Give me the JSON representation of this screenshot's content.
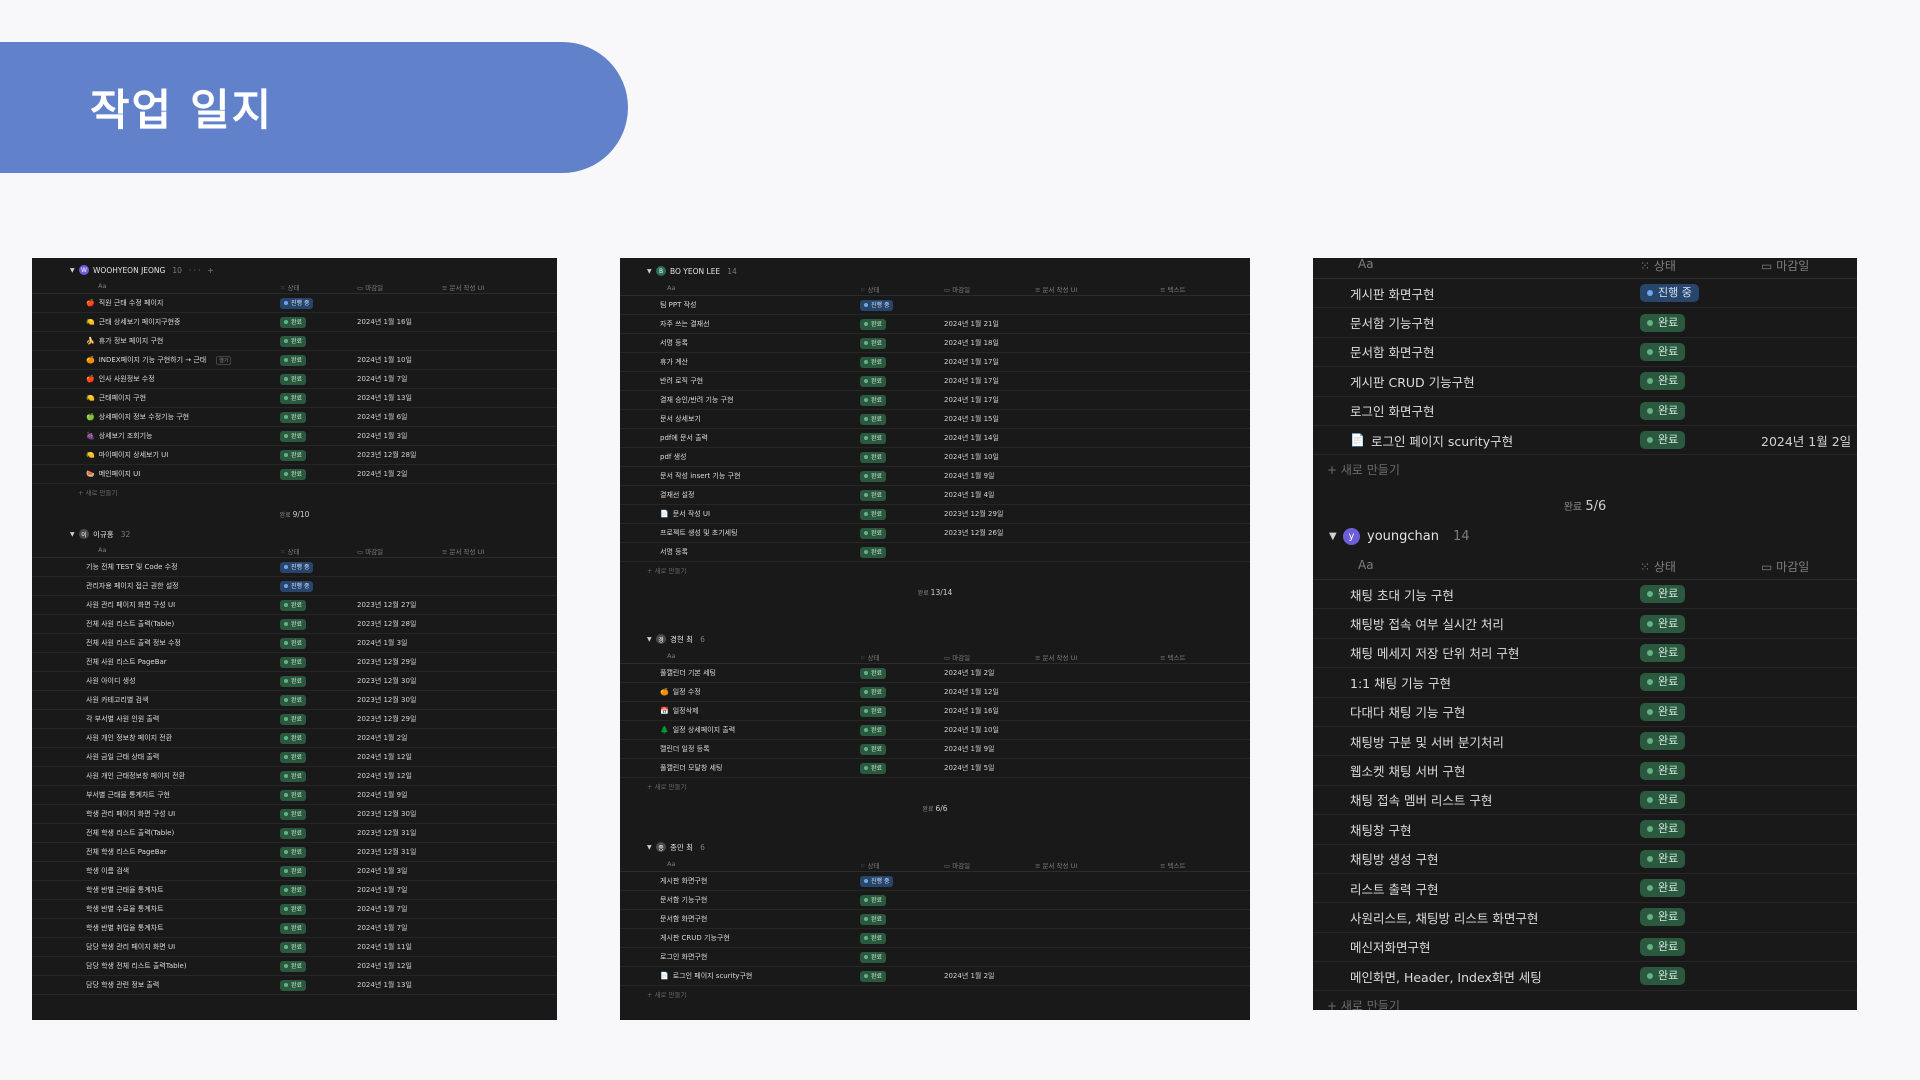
{
  "page": {
    "title": "작업 일지"
  },
  "labels": {
    "col_name": "Aa",
    "col_status": "상태",
    "col_deadline": "마감일",
    "col_doc": "문서 작성 UI",
    "col_text": "텍스트",
    "new_row": "+ 새로 만들기",
    "done": "완료"
  },
  "status": {
    "done": "완료",
    "progress": "진행 중"
  },
  "p1": {
    "g1": {
      "avatar": "W",
      "name": "WOOHYEON JEONG",
      "count": "10",
      "tools": "··· +",
      "summary": "9/10",
      "rows": [
        {
          "icon": "🍎",
          "name": "직원 근태 수정 페이지",
          "status": "진행 중",
          "date": ""
        },
        {
          "icon": "🍋",
          "name": "근태 상세보기 페이지구현중",
          "status": "완료",
          "date": "2024년 1월 16일"
        },
        {
          "icon": "🍌",
          "name": "휴가 정보 페이지 구현",
          "status": "완료",
          "date": ""
        },
        {
          "icon": "🍊",
          "name": "INDEX페이지 기능 구현하기 → 근태",
          "status": "완료",
          "date": "2024년 1월 10일",
          "tag": "열기"
        },
        {
          "icon": "🍎",
          "name": "인사 사원정보 수정",
          "status": "완료",
          "date": "2024년 1월 7일"
        },
        {
          "icon": "🍋",
          "name": "근태페이지 구현",
          "status": "완료",
          "date": "2024년 1월 13일"
        },
        {
          "icon": "🍏",
          "name": "상세페이지 정보 수정기능 구현",
          "status": "완료",
          "date": "2024년 1월 6일"
        },
        {
          "icon": "🍇",
          "name": "상세보기 조회기능",
          "status": "완료",
          "date": "2024년 1월 3일"
        },
        {
          "icon": "🍋",
          "name": "마이페이지 상세보기 UI",
          "status": "완료",
          "date": "2023년 12월 28일"
        },
        {
          "icon": "🍉",
          "name": "메인페이지 UI",
          "status": "완료",
          "date": "2024년 1월 2일"
        }
      ]
    },
    "g2": {
      "avatar": "이",
      "name": "이규홍",
      "count": "32",
      "rows": [
        {
          "name": "기능 전체 TEST 및 Code 수정",
          "status": "진행 중",
          "date": ""
        },
        {
          "name": "관리자용 페이지 접근 권한 설정",
          "status": "진행 중",
          "date": ""
        },
        {
          "name": "사원 관리 페이지 화면 구성 UI",
          "status": "완료",
          "date": "2023년 12월 27일"
        },
        {
          "name": "전체 사원 리스트 출력(Table)",
          "status": "완료",
          "date": "2023년 12월 28일"
        },
        {
          "name": "전체 사원 리스트 출력 정보 수정",
          "status": "완료",
          "date": "2024년 1월 3일"
        },
        {
          "name": "전체 사원 리스트 PageBar",
          "status": "완료",
          "date": "2023년 12월 29일"
        },
        {
          "name": "사원 아이디 생성",
          "status": "완료",
          "date": "2023년 12월 30일"
        },
        {
          "name": "사원 카테고리별 검색",
          "status": "완료",
          "date": "2023년 12월 30일"
        },
        {
          "name": "각 부서별 사원 인원 출력",
          "status": "완료",
          "date": "2023년 12월 29일"
        },
        {
          "name": "사원 개인 정보창 페이지 전환",
          "status": "완료",
          "date": "2024년 1월 2일"
        },
        {
          "name": "사원 금일 근태 상태 출력",
          "status": "완료",
          "date": "2024년 1월 12일"
        },
        {
          "name": "사원 개인 근태정보창 페이지 전환",
          "status": "완료",
          "date": "2024년 1월 12일"
        },
        {
          "name": "부서별 근태율 통계차트 구현",
          "status": "완료",
          "date": "2024년 1월 9일"
        },
        {
          "name": "학생 관리 페이지 화면 구성 UI",
          "status": "완료",
          "date": "2023년 12월 30일"
        },
        {
          "name": "전체 학생 리스트 출력(Table)",
          "status": "완료",
          "date": "2023년 12월 31일"
        },
        {
          "name": "전체 학생 리스트 PageBar",
          "status": "완료",
          "date": "2023년 12월 31일"
        },
        {
          "name": "학생 이름 검색",
          "status": "완료",
          "date": "2024년 1월 3일"
        },
        {
          "name": "학생 반별 근태율 통계차트",
          "status": "완료",
          "date": "2024년 1월 7일"
        },
        {
          "name": "학생 반별 수료율 통계차트",
          "status": "완료",
          "date": "2024년 1월 7일"
        },
        {
          "name": "학생 반별 취업율 통계차트",
          "status": "완료",
          "date": "2024년 1월 7일"
        },
        {
          "name": "담당 학생 관리 페이지 화면 UI",
          "status": "완료",
          "date": "2024년 1월 11일"
        },
        {
          "name": "담당 학생 전체 리스트 출력Table)",
          "status": "완료",
          "date": "2024년 1월 12일"
        },
        {
          "name": "담당 학생 관련 정보 출력",
          "status": "완료",
          "date": "2024년 1월 13일"
        }
      ]
    }
  },
  "p2": {
    "g1": {
      "avatar": "B",
      "name": "BO YEON LEE",
      "count": "14",
      "summary": "13/14",
      "rows": [
        {
          "name": "팀 PPT 작성",
          "status": "진행 중",
          "date": ""
        },
        {
          "name": "자주 쓰는 결재선",
          "status": "완료",
          "date": "2024년 1월 21일"
        },
        {
          "name": "서명 등록",
          "status": "완료",
          "date": "2024년 1월 18일"
        },
        {
          "name": "휴가 계산",
          "status": "완료",
          "date": "2024년 1월 17일"
        },
        {
          "name": "반려 로직 구현",
          "status": "완료",
          "date": "2024년 1월 17일"
        },
        {
          "name": "결재 승인/반려 기능 구현",
          "status": "완료",
          "date": "2024년 1월 17일"
        },
        {
          "name": "문서 상세보기",
          "status": "완료",
          "date": "2024년 1월 15일"
        },
        {
          "name": "pdf에 문서 출력",
          "status": "완료",
          "date": "2024년 1월 14일"
        },
        {
          "name": "pdf 생성",
          "status": "완료",
          "date": "2024년 1월 10일"
        },
        {
          "name": "문서 작성 insert 기능 구현",
          "status": "완료",
          "date": "2024년 1월 9일"
        },
        {
          "name": "결재선 설정",
          "status": "완료",
          "date": "2024년 1월 4일"
        },
        {
          "icon": "📄",
          "name": "문서 작성 UI",
          "status": "완료",
          "date": "2023년 12월 29일"
        },
        {
          "name": "프로젝트 생성 및 초기세팅",
          "status": "완료",
          "date": "2023년 12월 26일"
        },
        {
          "name": "서명 등록",
          "status": "완료",
          "date": ""
        }
      ]
    },
    "g2": {
      "avatar": "경",
      "name": "경현 최",
      "count": "6",
      "summary": "6/6",
      "rows": [
        {
          "name": "풀캘린더 기본 세팅",
          "status": "완료",
          "date": "2024년 1월 2일"
        },
        {
          "icon": "🍊",
          "name": "일정 수정",
          "status": "완료",
          "date": "2024년 1월 12일"
        },
        {
          "icon": "📅",
          "name": "일정삭제",
          "status": "완료",
          "date": "2024년 1월 16일"
        },
        {
          "icon": "🌲",
          "name": "일정 상세페이지 출력",
          "status": "완료",
          "date": "2024년 1월 10일"
        },
        {
          "name": "캘린더 일정 등록",
          "status": "완료",
          "date": "2024년 1월 9일"
        },
        {
          "name": "풀캘린더 모달창 세팅",
          "status": "완료",
          "date": "2024년 1월 5일"
        }
      ]
    },
    "g3": {
      "avatar": "종",
      "name": "종민 최",
      "count": "6",
      "rows": [
        {
          "name": "게시판 화면구현",
          "status": "진행 중",
          "date": ""
        },
        {
          "name": "문서함 기능구현",
          "status": "완료",
          "date": ""
        },
        {
          "name": "문서함 화면구현",
          "status": "완료",
          "date": ""
        },
        {
          "name": "게시판 CRUD 기능구현",
          "status": "완료",
          "date": ""
        },
        {
          "name": "로그인 화면구현",
          "status": "완료",
          "date": ""
        },
        {
          "icon": "📄",
          "name": "로그인 페이지 scurity구현",
          "status": "완료",
          "date": "2024년 1월 2일"
        }
      ]
    }
  },
  "p3": {
    "g1": {
      "summary": "5/6",
      "rows": [
        {
          "name": "게시판 화면구현",
          "status": "진행 중",
          "date": ""
        },
        {
          "name": "문서함 기능구현",
          "status": "완료",
          "date": ""
        },
        {
          "name": "문서함 화면구현",
          "status": "완료",
          "date": ""
        },
        {
          "name": "게시판 CRUD 기능구현",
          "status": "완료",
          "date": ""
        },
        {
          "name": "로그인 화면구현",
          "status": "완료",
          "date": ""
        },
        {
          "icon": "📄",
          "name": "로그인 페이지 scurity구현",
          "status": "완료",
          "date": "2024년 1월 2일"
        }
      ]
    },
    "g2": {
      "avatar": "y",
      "name": "youngchan",
      "count": "14",
      "rows": [
        {
          "name": "채팅 초대 기능 구현",
          "status": "완료"
        },
        {
          "name": "채팅방 접속 여부 실시간 처리",
          "status": "완료"
        },
        {
          "name": "채팅 메세지 저장 단위 처리 구현",
          "status": "완료"
        },
        {
          "name": "1:1 채팅 기능 구현",
          "status": "완료"
        },
        {
          "name": "다대다 채팅 기능 구현",
          "status": "완료"
        },
        {
          "name": "채팅방 구분 및 서버 분기처리",
          "status": "완료"
        },
        {
          "name": "웹소켓 채팅 서버 구현",
          "status": "완료"
        },
        {
          "name": "채팅 접속 멤버 리스트 구현",
          "status": "완료"
        },
        {
          "name": "채팅창 구현",
          "status": "완료"
        },
        {
          "name": "채팅방 생성 구현",
          "status": "완료"
        },
        {
          "name": "리스트 출력 구현",
          "status": "완료"
        },
        {
          "name": "사원리스트, 채팅방 리스트 화면구현",
          "status": "완료"
        },
        {
          "name": "메신저화면구현",
          "status": "완료"
        },
        {
          "name": "메인화면, Header, Index화면 세팅",
          "status": "완료"
        }
      ]
    }
  }
}
